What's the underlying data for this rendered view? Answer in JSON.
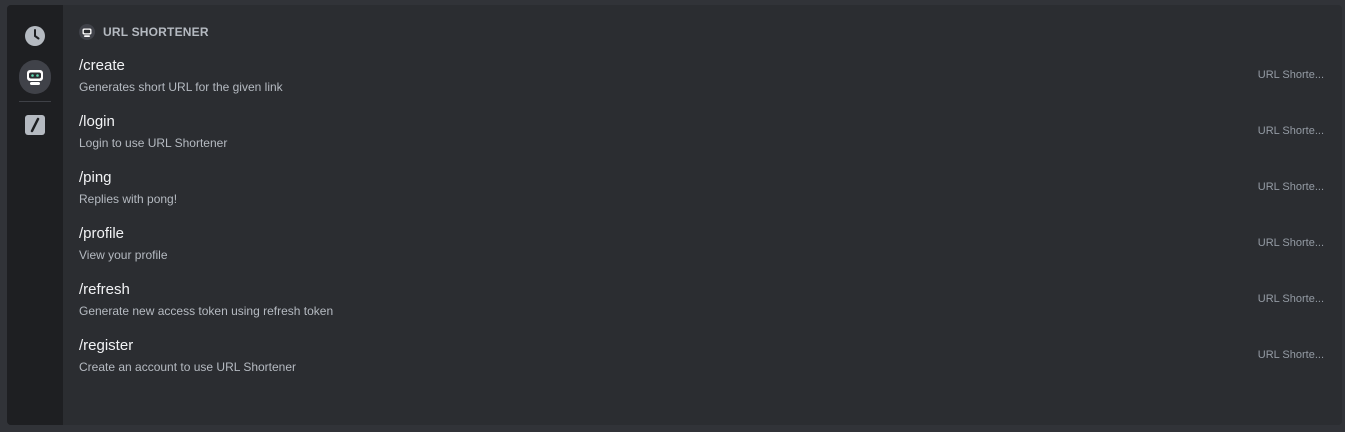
{
  "rail": {
    "items": [
      {
        "icon": "clock-icon",
        "label": "Recent"
      },
      {
        "icon": "bot-avatar-icon",
        "label": "URL Shortener"
      },
      {
        "icon": "slash-command-icon",
        "label": "Built-in"
      }
    ]
  },
  "section": {
    "title": "URL SHORTENER",
    "icon": "bot-avatar-icon"
  },
  "commands": [
    {
      "name": "/create",
      "description": "Generates short URL for the given link",
      "source": "URL Shorte..."
    },
    {
      "name": "/login",
      "description": "Login to use URL Shortener",
      "source": "URL Shorte..."
    },
    {
      "name": "/ping",
      "description": "Replies with pong!",
      "source": "URL Shorte..."
    },
    {
      "name": "/profile",
      "description": "View your profile",
      "source": "URL Shorte..."
    },
    {
      "name": "/refresh",
      "description": "Generate new access token using refresh token",
      "source": "URL Shorte..."
    },
    {
      "name": "/register",
      "description": "Create an account to use URL Shortener",
      "source": "URL Shorte..."
    }
  ],
  "colors": {
    "background": "#313338",
    "panel": "#2b2d31",
    "rail": "#1e1f22",
    "text_primary": "#f2f3f5",
    "text_secondary": "#b5bac1",
    "text_muted": "#949ba4"
  }
}
